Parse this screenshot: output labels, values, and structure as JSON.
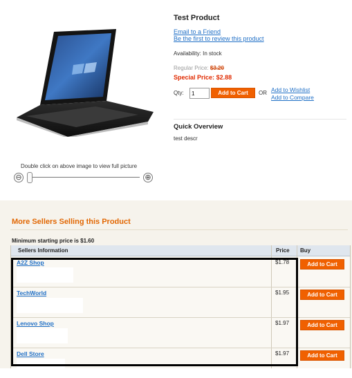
{
  "product": {
    "title": "Test Product",
    "email_link": "Email to a Friend",
    "review_link": "Be the first to review this product",
    "availability": "Availability: In stock",
    "regular_label": "Regular Price:",
    "regular_value": "$3.20",
    "special_label": "Special Price:",
    "special_value": "$2.88",
    "qty_label": "Qty:",
    "qty_value": "1",
    "add_to_cart": "Add to Cart",
    "or_text": "OR",
    "wishlist_link": "Add to Wishlist",
    "compare_link": "Add to Compare",
    "overview_heading": "Quick Overview",
    "overview_text": "test descr"
  },
  "image": {
    "hint": "Double click on above image to view full picture",
    "zoom_out": "⊖",
    "zoom_in": "⊕",
    "zoom_level": 0
  },
  "sellers": {
    "heading": "More Sellers Selling this Product",
    "min_price": "Minimum starting price is $1.60",
    "columns": [
      "Sellers Information",
      "Price",
      "Buy"
    ],
    "rows": [
      {
        "name": "A2Z Shop",
        "price": "$1.78",
        "button": "Add to Cart"
      },
      {
        "name": "TechWorld",
        "price": "$1.95",
        "button": "Add to Cart"
      },
      {
        "name": "Lenovo Shop",
        "price": "$1.97",
        "button": "Add to Cart"
      },
      {
        "name": "Dell Store",
        "price": "$1.97",
        "button": "Add to Cart"
      }
    ]
  },
  "colors": {
    "accent_orange": "#f06000",
    "heading_orange": "#e26703",
    "link_blue": "#1f6fc6",
    "special_red": "#e02a00"
  }
}
